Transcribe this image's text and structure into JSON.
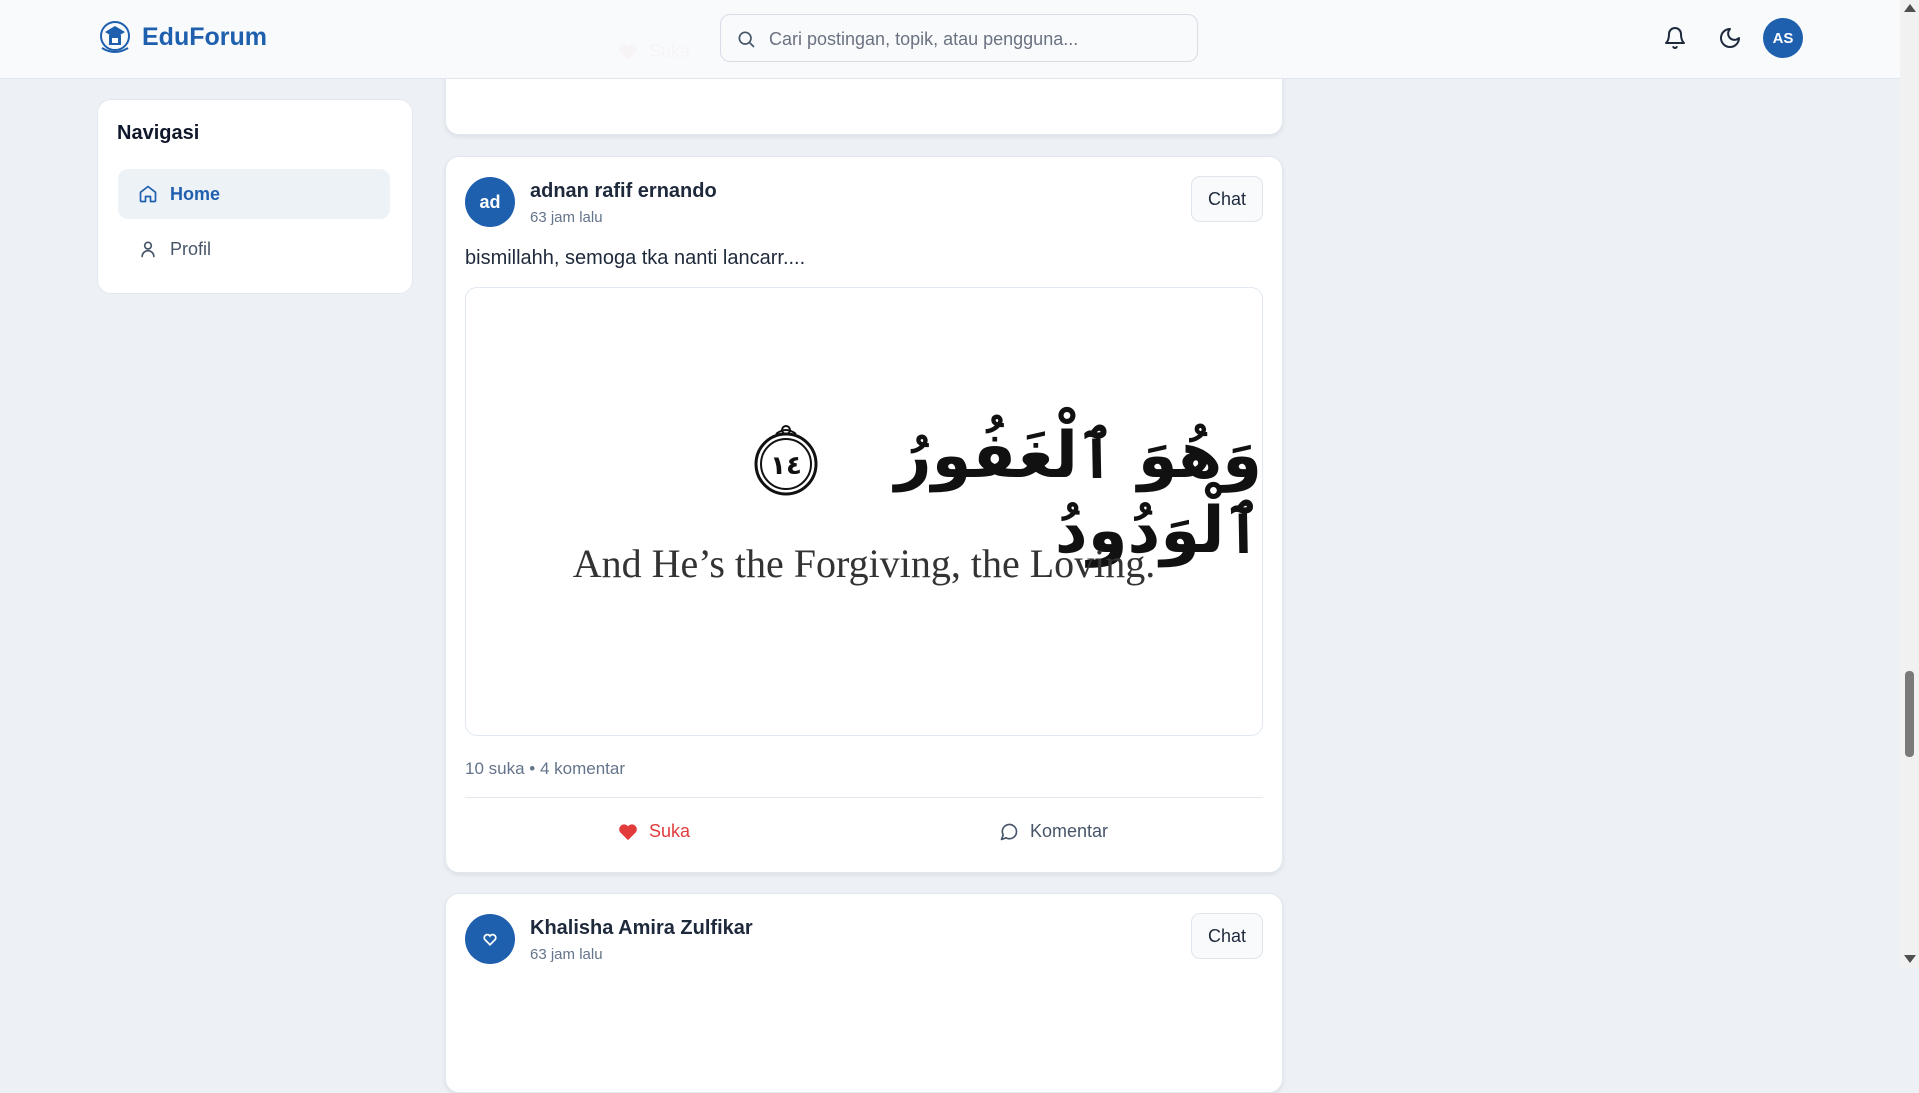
{
  "header": {
    "brand": "EduForum",
    "search_placeholder": "Cari postingan, topik, atau pengguna...",
    "user_initials": "AS"
  },
  "sidebar": {
    "title": "Navigasi",
    "items": [
      {
        "label": "Home",
        "icon": "home-icon",
        "active": true
      },
      {
        "label": "Profil",
        "icon": "user-icon",
        "active": false
      }
    ]
  },
  "actions": {
    "like_label": "Suka",
    "comment_label": "Komentar",
    "chat_label": "Chat"
  },
  "posts": [
    {
      "avatar": "ad",
      "author": "adnan rafif ernando",
      "time": "63 jam lalu",
      "text": "bismillahh, semoga tka nanti lancarr....",
      "image_arabic": "وَهُوَ ٱلْغَفُورُ ٱلْوَدُودُ",
      "image_verse_number": "١٤",
      "image_english": "And He’s the Forgiving, the Loving.",
      "stats": "10 suka • 4 komentar"
    },
    {
      "author": "Khalisha Amira Zulfikar",
      "time": "63 jam lalu"
    }
  ],
  "colors": {
    "brand": "#1e5fae",
    "like": "#e23b3b",
    "background": "#edf1f5"
  }
}
